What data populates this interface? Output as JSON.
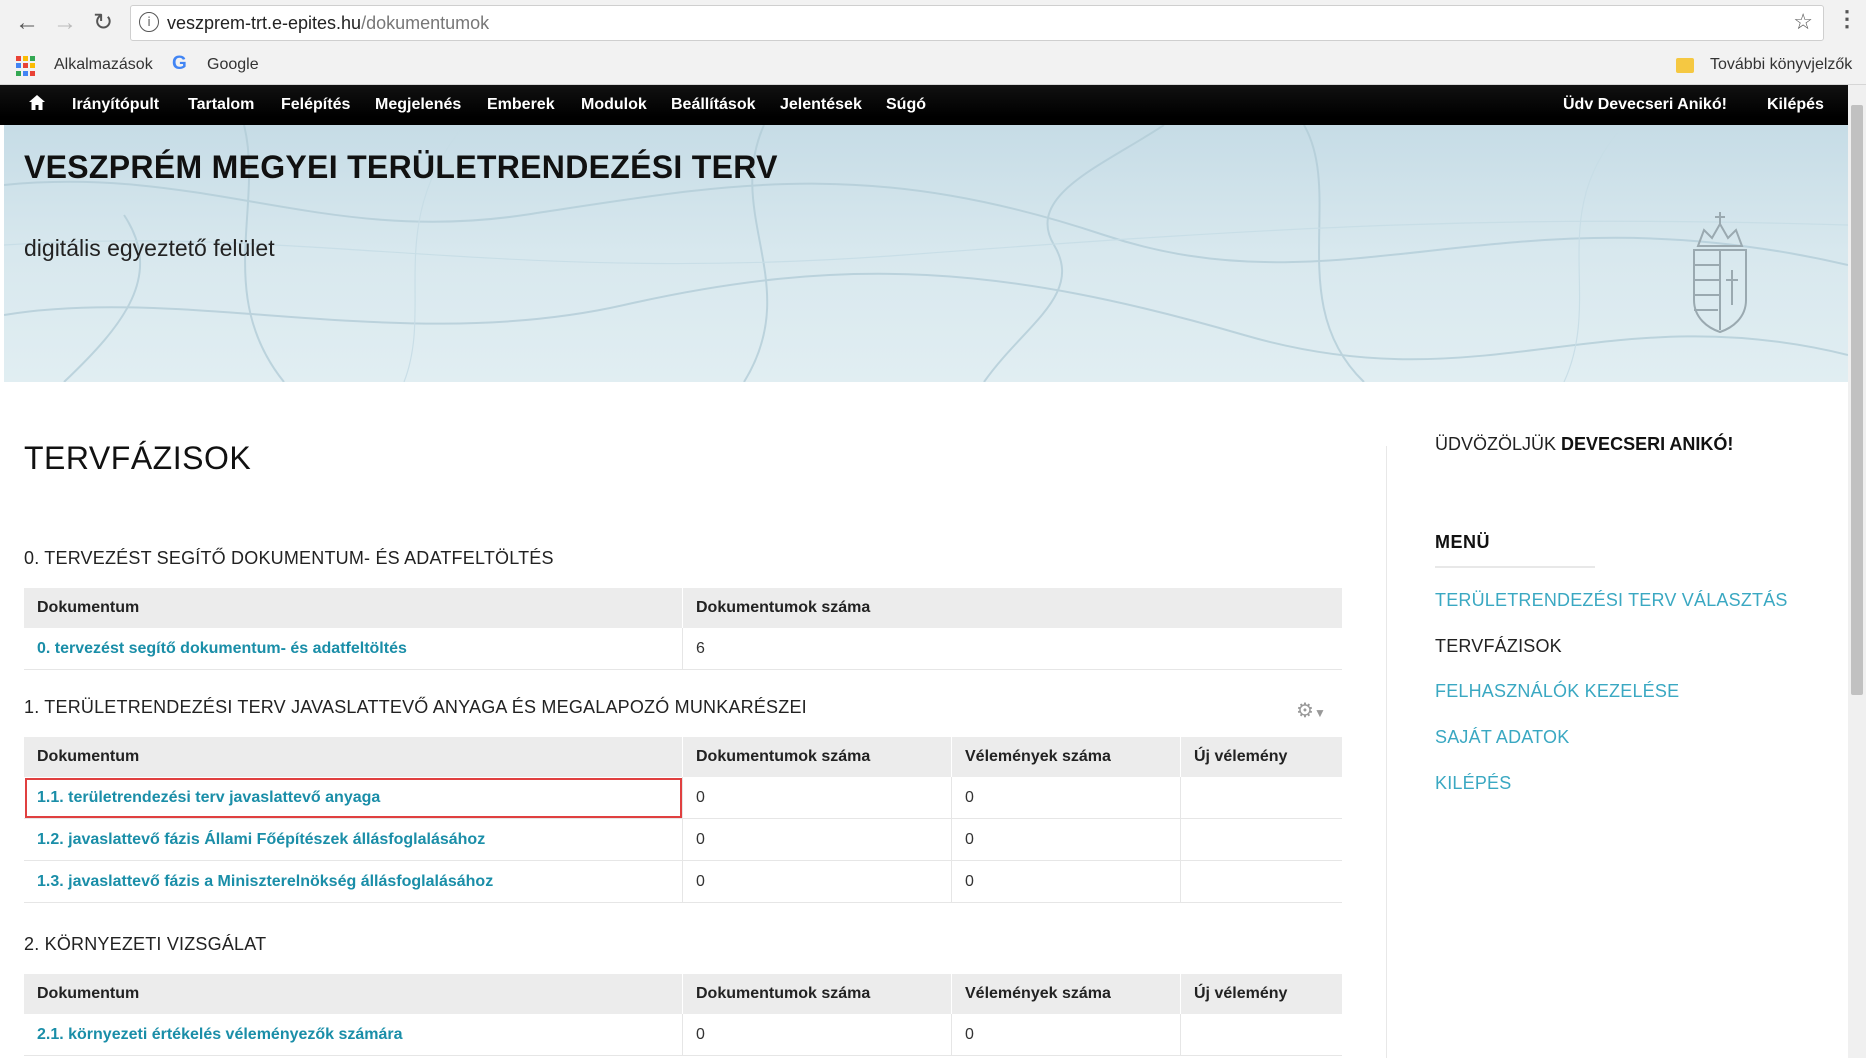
{
  "browser": {
    "url_host": "veszprem-trt.e-epites.hu",
    "url_path": "/dokumentumok",
    "bookmarks": {
      "apps": "Alkalmazások",
      "google": "Google",
      "other": "További könyvjelzők"
    }
  },
  "toolbar": {
    "items": [
      "Irányítópult",
      "Tartalom",
      "Felépítés",
      "Megjelenés",
      "Emberek",
      "Modulok",
      "Beállítások",
      "Jelentések",
      "Súgó"
    ],
    "greeting_prefix": "Üdv",
    "user_name": "Devecseri Anikó",
    "greeting_suffix": "!",
    "logout": "Kilépés"
  },
  "header": {
    "title": "VESZPRÉM MEGYEI TERÜLETRENDEZÉSI TERV",
    "slogan": "digitális egyeztető felület"
  },
  "main": {
    "page_title": "TERVFÁZISOK",
    "sections": [
      {
        "title": "0. TERVEZÉST SEGÍTŐ DOKUMENTUM- ÉS ADATFELTÖLTÉS",
        "headers": [
          "Dokumentum",
          "Dokumentumok száma"
        ],
        "rows": [
          {
            "doc": "0. tervezést segítő dokumentum- és adatfeltöltés",
            "count": "6"
          }
        ]
      },
      {
        "title": "1. TERÜLETRENDEZÉSI TERV JAVASLATTEVŐ ANYAGA ÉS MEGALAPOZÓ MUNKARÉSZEI",
        "headers": [
          "Dokumentum",
          "Dokumentumok száma",
          "Vélemények száma",
          "Új vélemény"
        ],
        "rows": [
          {
            "doc": "1.1. területrendezési terv javaslattevő anyaga",
            "count": "0",
            "opinions": "0",
            "new": ""
          },
          {
            "doc": "1.2. javaslattevő fázis Állami Főépítészek állásfoglalásához",
            "count": "0",
            "opinions": "0",
            "new": ""
          },
          {
            "doc": "1.3. javaslattevő fázis a Miniszterelnökség állásfoglalásához",
            "count": "0",
            "opinions": "0",
            "new": ""
          }
        ]
      },
      {
        "title": "2. KÖRNYEZETI VIZSGÁLAT",
        "headers": [
          "Dokumentum",
          "Dokumentumok száma",
          "Vélemények száma",
          "Új vélemény"
        ],
        "rows": [
          {
            "doc": "2.1. környezeti értékelés véleményezők számára",
            "count": "0",
            "opinions": "0",
            "new": ""
          }
        ]
      }
    ]
  },
  "sidebar": {
    "welcome_prefix": "ÜDVÖZÖLJÜK",
    "welcome_name": "DEVECSERI ANIKÓ!",
    "menu_title": "MENÜ",
    "menu_items": [
      "TERÜLETRENDEZÉSI TERV VÁLASZTÁS",
      "TERVFÁZISOK",
      "FELHASZNÁLÓK KEZELÉSE",
      "SAJÁT ADATOK",
      "KILÉPÉS"
    ]
  },
  "colors": {
    "link": "#1a8ea8",
    "menu_link": "#3aa8c2",
    "highlight": "#e04040",
    "toolbar": "#000000"
  }
}
